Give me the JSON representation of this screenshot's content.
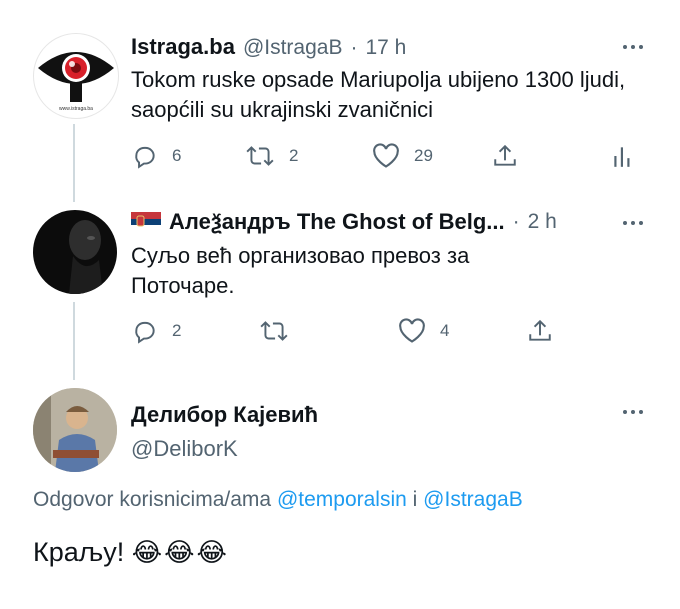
{
  "tweet1": {
    "display_name": "Istraga.ba",
    "handle": "@IstragaB",
    "separator": "·",
    "time": "17 h",
    "text": "Tokom ruske opsade Mariupolja ubijeno 1300 ljudi, saopćili su ukrajinski zvaničnici",
    "avatar_caption": "www.istraga.ba",
    "replies": "6",
    "retweets": "2",
    "likes": "29"
  },
  "tweet2": {
    "display_name": "Алеѯандръ The Ghost of Belg...",
    "separator": "·",
    "time": "2 h",
    "flag": "Serbia",
    "text": "Суљо већ организовао превоз за Поточаре.",
    "replies": "2",
    "likes": "4"
  },
  "tweet3": {
    "display_name": "Делибор Кајевић",
    "handle": "@DeliborK",
    "reply_prefix": "Odgovor korisnicima/ama",
    "reply_user1": "@temporalsin",
    "reply_conj": "i",
    "reply_user2": "@IstragaB",
    "text": "Краљу!",
    "emoji": "😂😂😂"
  },
  "colors": {
    "text": "#0f1419",
    "muted": "#536471",
    "link": "#1d9bf0",
    "thread_line": "#cfd9de",
    "eye_red": "#d8202a"
  }
}
